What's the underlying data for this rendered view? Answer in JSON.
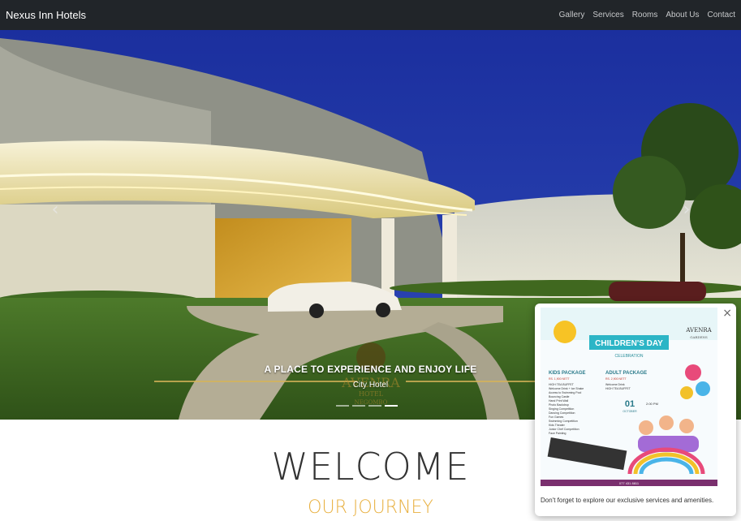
{
  "navbar": {
    "brand": "Nexus Inn Hotels",
    "links": [
      "Gallery",
      "Services",
      "Rooms",
      "About Us",
      "Contact"
    ]
  },
  "hero": {
    "heading": "A PLACE TO EXPERIENCE AND ENJOY LIFE",
    "subheading": "City Hotel",
    "logo_text": "AVENRA",
    "logo_sub": "HOTEL",
    "logo_place": "NEGOMBO",
    "prev_icon": "chevron-left-icon",
    "next_icon": "chevron-right-icon",
    "slide_count": 4,
    "active_slide": 4
  },
  "main": {
    "title": "WELCOME",
    "subtitle": "OUR JOURNEY"
  },
  "popup": {
    "close_label": "×",
    "message": "Don't forget to explore our exclusive services and amenities.",
    "poster": {
      "title": "CHILDREN'S DAY",
      "title_sub": "CELEBRATION",
      "brand": "AVENRA",
      "brand_sub": "GARDENS",
      "kids_package": "KIDS PACKAGE",
      "adult_package": "ADULT PACKAGE",
      "kids_price": "RS. 1,900 NETT",
      "adult_price": "RS. 2,900 NETT",
      "date_day": "01",
      "date_month": "OCTOBER",
      "kids_items": [
        "HIGH TEA BUFFET",
        "Welcome Drink + Ice Shake",
        "Access to Swimming Pool",
        "Bouncing Castle",
        "Hand Print Wall",
        "Photo Backdrop",
        "Singing Competition",
        "Dancing Competition",
        "Fun Games",
        "Swimming Competition",
        "Kids Theater",
        "Junior Chef Competition",
        "Face Painting"
      ],
      "adult_items": [
        "Welcome Drink",
        "HIGH TEA BUFFET"
      ],
      "time": "2:00 PM",
      "phone": "077 431 8811"
    }
  },
  "colors": {
    "navbar_bg": "#212529",
    "accent_gold": "#e8b040",
    "sky": "#1f2f8a"
  }
}
